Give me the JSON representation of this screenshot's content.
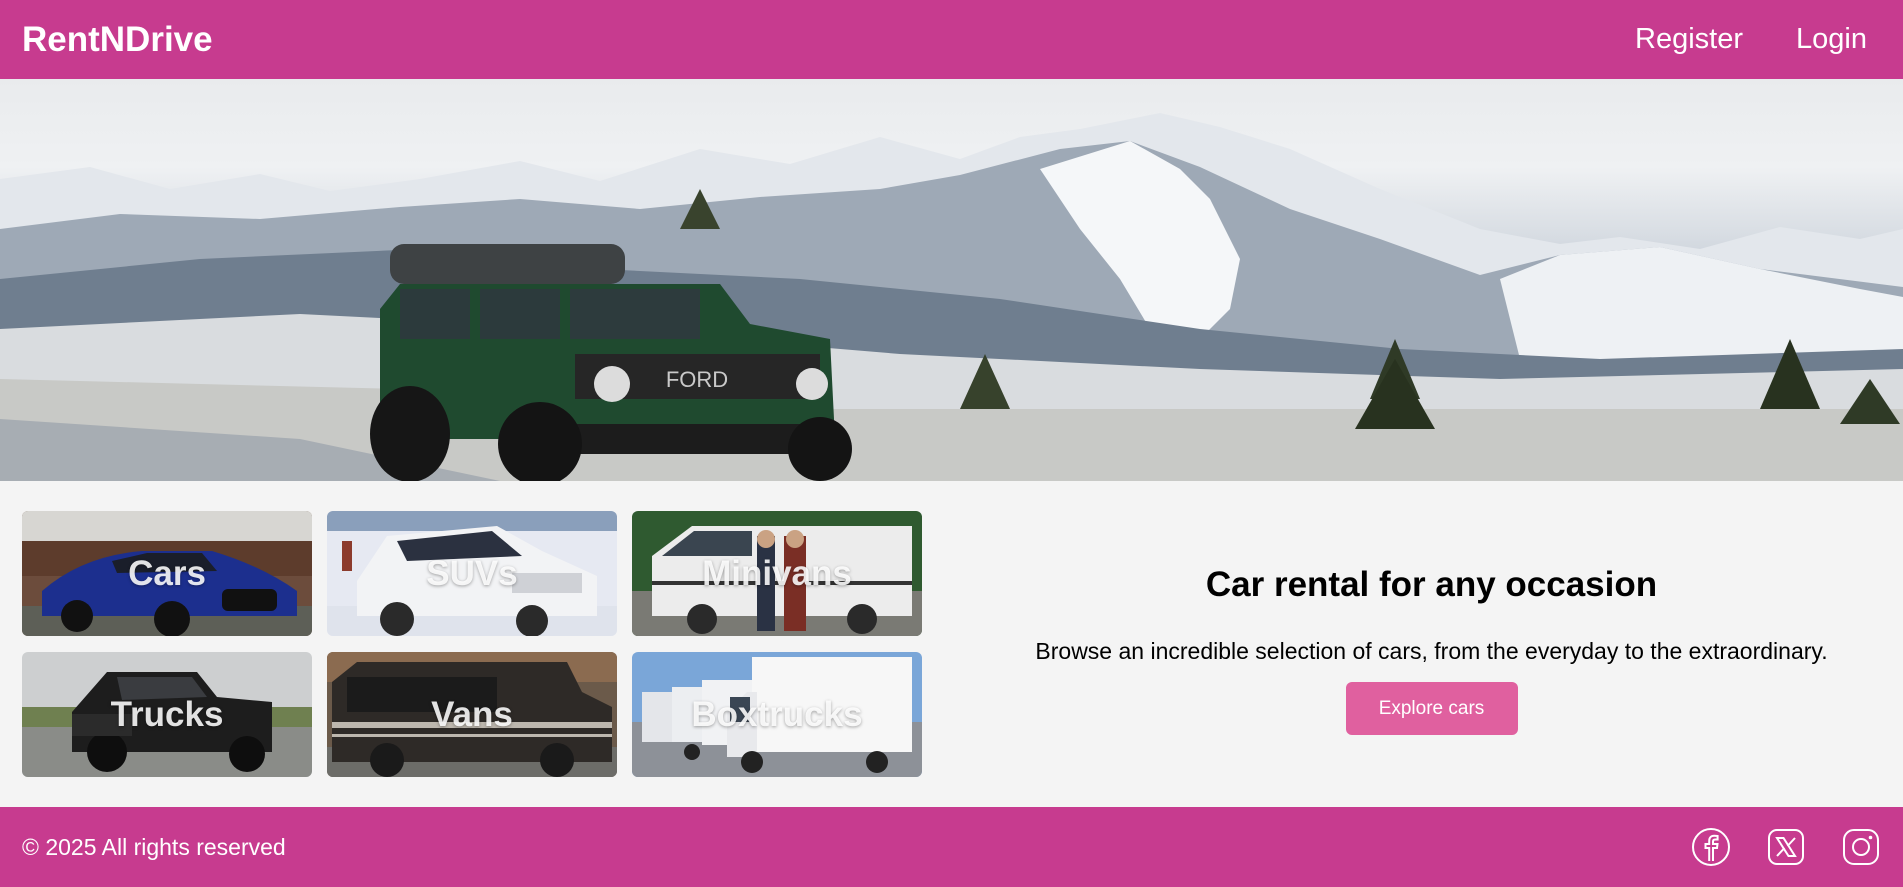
{
  "header": {
    "brand": "RentNDrive",
    "nav": {
      "register": "Register",
      "login": "Login"
    }
  },
  "hero": {
    "image": "ford-bronco-mountain-scene"
  },
  "categories": [
    {
      "label": "Cars",
      "icon": "sedan-photo"
    },
    {
      "label": "SUVs",
      "icon": "suv-photo"
    },
    {
      "label": "Minivans",
      "icon": "minivan-photo"
    },
    {
      "label": "Trucks",
      "icon": "pickup-truck-photo"
    },
    {
      "label": "Vans",
      "icon": "van-photo"
    },
    {
      "label": "Boxtrucks",
      "icon": "box-truck-photo"
    }
  ],
  "promo": {
    "title": "Car rental for any occasion",
    "subtitle": "Browse an incredible selection of cars, from the everyday to the extraordinary.",
    "button": "Explore cars"
  },
  "footer": {
    "copyright": "© 2025 All rights reserved",
    "social": [
      "facebook-icon",
      "x-icon",
      "instagram-icon"
    ]
  },
  "colors": {
    "brand": "#c73b8f",
    "button": "#e0609f",
    "background": "#f4f4f4"
  }
}
